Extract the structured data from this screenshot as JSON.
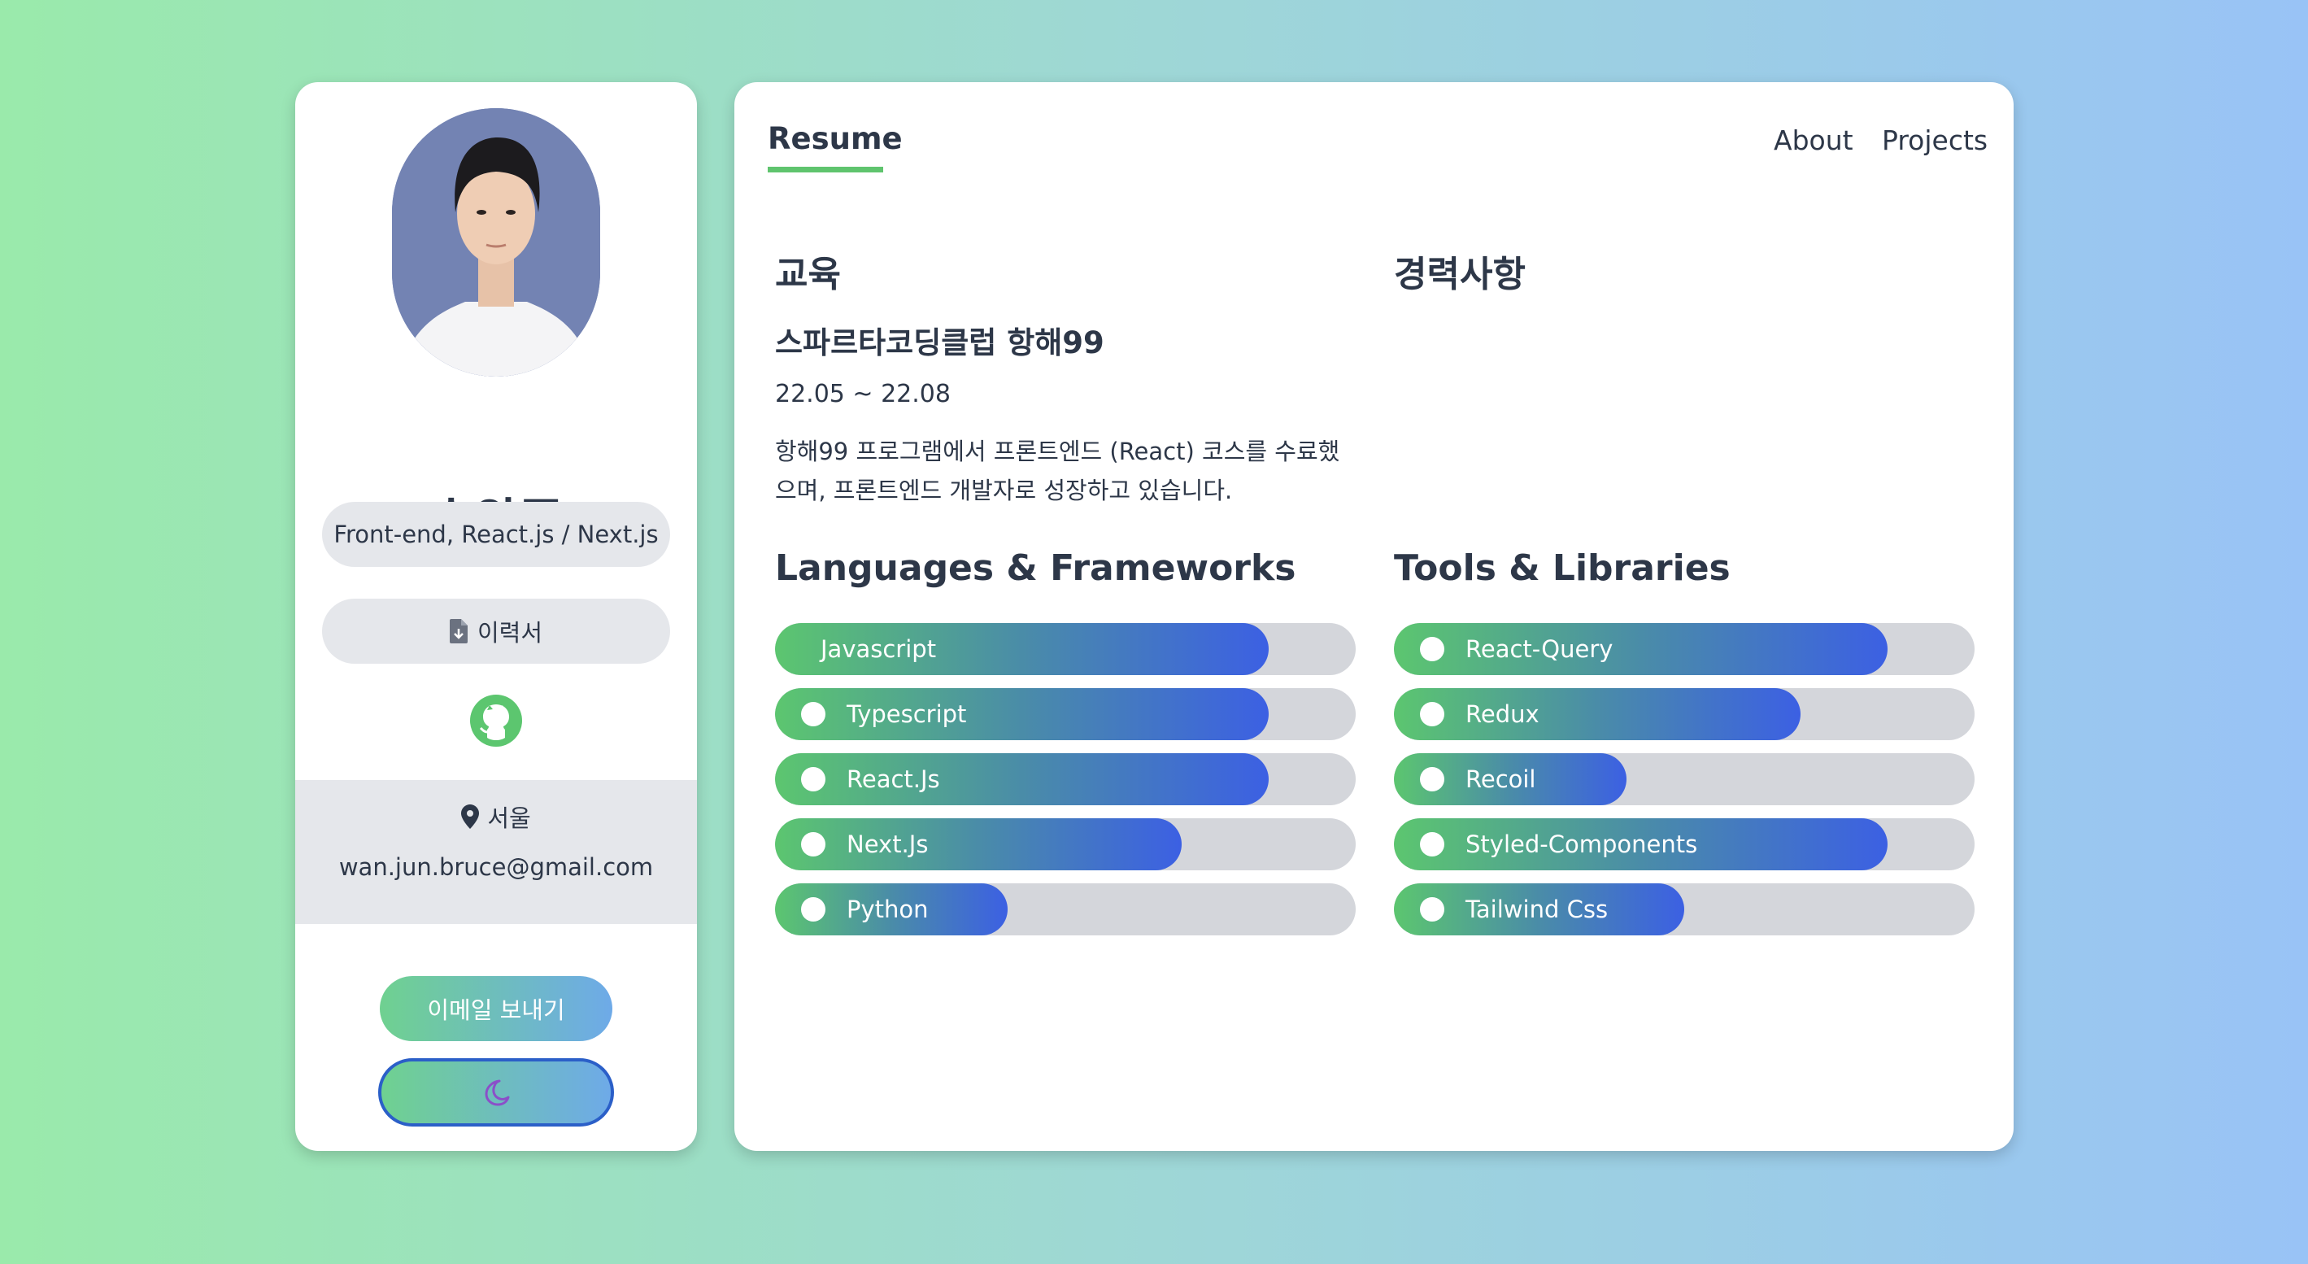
{
  "profile": {
    "name": "송완준",
    "role": "Front-end, React.js / Next.js",
    "resume_label": "이력서",
    "location": "서울",
    "email": "wan.jun.bruce@gmail.com",
    "email_button": "이메일 보내기",
    "avatar_icon": "profile-photo",
    "github_icon": "github-icon",
    "theme_icon": "moon-icon"
  },
  "nav": {
    "active_tab": "Resume",
    "about": "About",
    "projects": "Projects"
  },
  "education": {
    "heading": "교육",
    "school": "스파르타코딩클럽 항해99",
    "period": "22.05 ~ 22.08",
    "description": "항해99 프로그램에서 프론트엔드 (React) 코스를 수료했으며, 프론트엔드 개발자로 성장하고 있습니다."
  },
  "career": {
    "heading": "경력사항"
  },
  "languages": {
    "heading": "Languages & Frameworks",
    "items": [
      {
        "label": "Javascript",
        "level": 0.85,
        "dot": false
      },
      {
        "label": "Typescript",
        "level": 0.85,
        "dot": true
      },
      {
        "label": "React.Js",
        "level": 0.85,
        "dot": true
      },
      {
        "label": "Next.Js",
        "level": 0.7,
        "dot": true
      },
      {
        "label": "Python",
        "level": 0.4,
        "dot": true
      }
    ]
  },
  "tools": {
    "heading": "Tools & Libraries",
    "items": [
      {
        "label": "React-Query",
        "level": 0.85,
        "dot": true
      },
      {
        "label": "Redux",
        "level": 0.7,
        "dot": true
      },
      {
        "label": "Recoil",
        "level": 0.4,
        "dot": true
      },
      {
        "label": "Styled-Components",
        "level": 0.85,
        "dot": true
      },
      {
        "label": "Tailwind Css",
        "level": 0.5,
        "dot": true
      }
    ]
  },
  "colors": {
    "accent_green": "#5fc46e",
    "bar_gradient_start": "#5cc66f",
    "bar_gradient_end": "#3c60e3",
    "github_green": "#5cc66f",
    "moon_purple": "#8b4fc9"
  }
}
